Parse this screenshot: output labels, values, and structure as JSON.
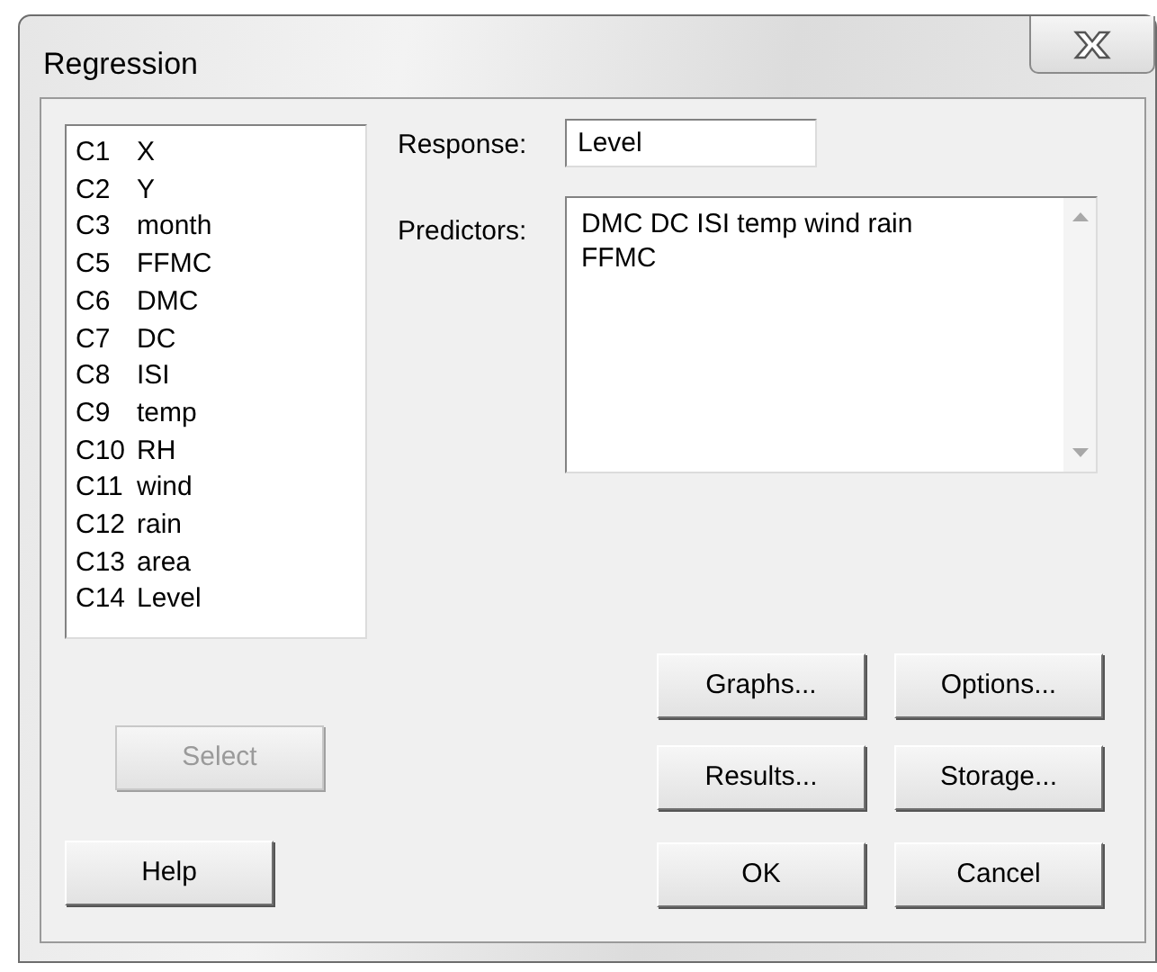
{
  "window": {
    "title": "Regression"
  },
  "columns": [
    {
      "id": "C1",
      "name": "X"
    },
    {
      "id": "C2",
      "name": "Y"
    },
    {
      "id": "C3",
      "name": "month"
    },
    {
      "id": "C5",
      "name": "FFMC"
    },
    {
      "id": "C6",
      "name": "DMC"
    },
    {
      "id": "C7",
      "name": "DC"
    },
    {
      "id": "C8",
      "name": "ISI"
    },
    {
      "id": "C9",
      "name": "temp"
    },
    {
      "id": "C10",
      "name": "RH"
    },
    {
      "id": "C11",
      "name": "wind"
    },
    {
      "id": "C12",
      "name": "rain"
    },
    {
      "id": "C13",
      "name": "area"
    },
    {
      "id": "C14",
      "name": "Level"
    }
  ],
  "response": {
    "label": "Response:",
    "value": "Level"
  },
  "predictors": {
    "label": "Predictors:",
    "lines": [
      "DMC DC ISI temp wind rain",
      "FFMC"
    ]
  },
  "select_button": {
    "label": "Select",
    "disabled": true
  },
  "help_button": {
    "label": "Help"
  },
  "buttons": [
    {
      "label": "Graphs..."
    },
    {
      "label": "Options..."
    },
    {
      "label": "Results..."
    },
    {
      "label": "Storage..."
    },
    {
      "label": "OK"
    },
    {
      "label": "Cancel"
    }
  ]
}
